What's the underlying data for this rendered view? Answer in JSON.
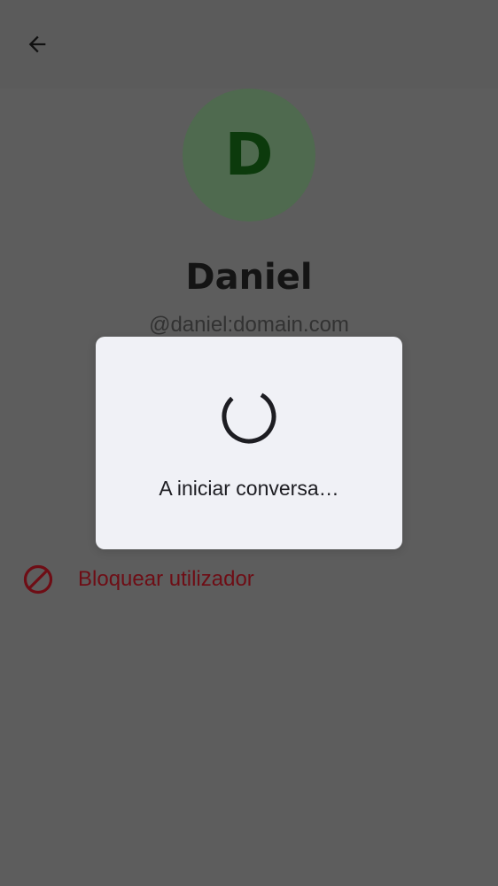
{
  "header": {
    "back_icon": "arrow-left-icon"
  },
  "profile": {
    "avatar_letter": "D",
    "avatar_color": "#4f6a4f",
    "name": "Daniel",
    "user_id": "@daniel:domain.com"
  },
  "actions": {
    "block_icon": "block-icon",
    "block_label": "Bloquear utilizador",
    "block_color": "#6e0d15"
  },
  "dialog": {
    "spinner_icon": "spinner-icon",
    "message": "A iniciar conversa…"
  }
}
